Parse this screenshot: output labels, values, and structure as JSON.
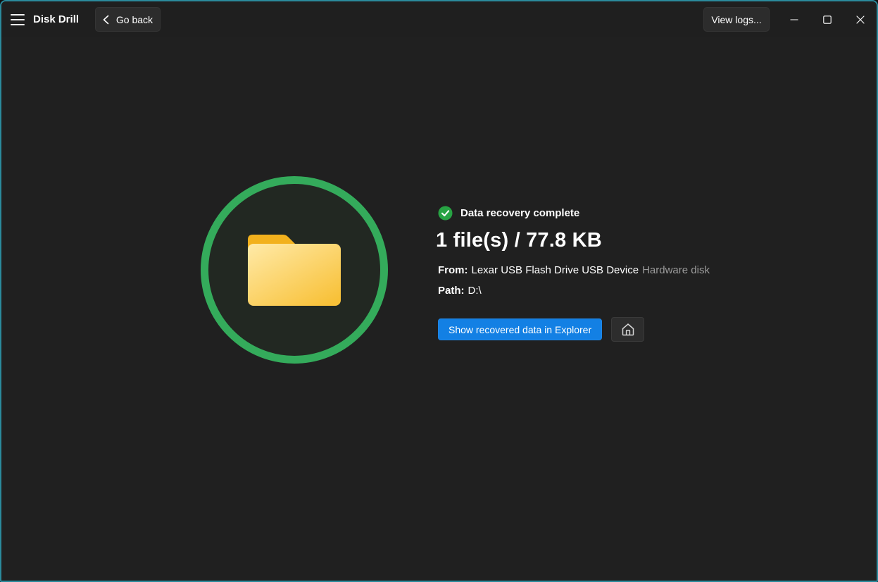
{
  "titlebar": {
    "app_title": "Disk Drill",
    "go_back_label": "Go back",
    "view_logs_label": "View logs..."
  },
  "recovery": {
    "status_text": "Data recovery complete",
    "summary_text": "1 file(s) / 77.8 KB",
    "from_label": "From:",
    "from_device": "Lexar USB Flash Drive USB Device",
    "from_disk_type": "Hardware disk",
    "path_label": "Path:",
    "path_value": "D:\\",
    "show_in_explorer_label": "Show recovered data in Explorer"
  },
  "icons": {
    "menu": "hamburger-menu-icon",
    "back": "chevron-left-icon",
    "minimize": "minimize-icon",
    "maximize": "maximize-icon",
    "close": "close-icon",
    "status": "check-circle-icon",
    "hero": "folder-icon",
    "home": "home-icon"
  },
  "colors": {
    "window_border": "#2b8a9c",
    "accent_blue": "#1380e4",
    "success_green": "#27a343",
    "ring_green": "#34ab5b",
    "folder_tab": "#f2b11d",
    "folder_body_light": "#ffe9a6",
    "folder_body_dark": "#f8c138",
    "muted_text": "#9b9b9b"
  }
}
